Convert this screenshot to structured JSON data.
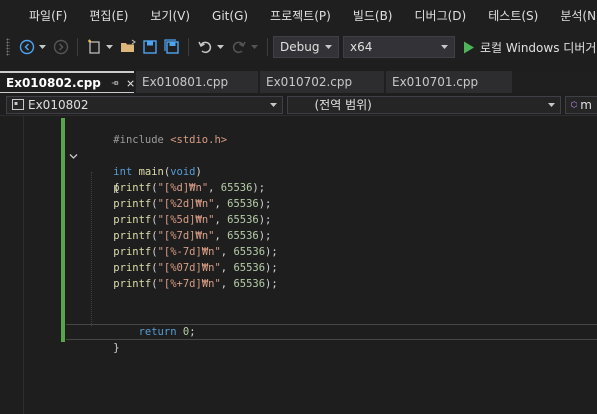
{
  "menu": [
    "파일(F)",
    "편집(E)",
    "보기(V)",
    "Git(G)",
    "프로젝트(P)",
    "빌드(B)",
    "디버그(D)",
    "테스트(S)",
    "분석(N)"
  ],
  "toolbar": {
    "config": "Debug",
    "platform": "x64",
    "run_label": "로컬 Windows 디버거"
  },
  "tabs": [
    {
      "label": "Ex010802.cpp",
      "active": true
    },
    {
      "label": "Ex010801.cpp",
      "active": false
    },
    {
      "label": "Ex010702.cpp",
      "active": false
    },
    {
      "label": "Ex010701.cpp",
      "active": false
    }
  ],
  "navbar": {
    "project": "Ex010802",
    "scope": "(전역 범위)",
    "member": "m"
  },
  "code": {
    "include": "#include",
    "header": "<stdio.h>",
    "sig_type": "int",
    "sig_name": "main",
    "sig_arg": "void",
    "open_brace": "{",
    "printf_fn": "printf",
    "formats": [
      "\"[%d]₩n\"",
      "\"[%2d]₩n\"",
      "\"[%5d]₩n\"",
      "\"[%7d]₩n\"",
      "\"[%-7d]₩n\"",
      "\"[%07d]₩n\"",
      "\"[%+7d]₩n\""
    ],
    "arg": "65536",
    "return_kw": "return",
    "return_val": "0",
    "close_brace": "}"
  },
  "colors": {
    "accent_green": "#57a64a",
    "keyword": "#569cd6",
    "function": "#dcdcaa",
    "string": "#d69d85",
    "number": "#b5cea8"
  }
}
